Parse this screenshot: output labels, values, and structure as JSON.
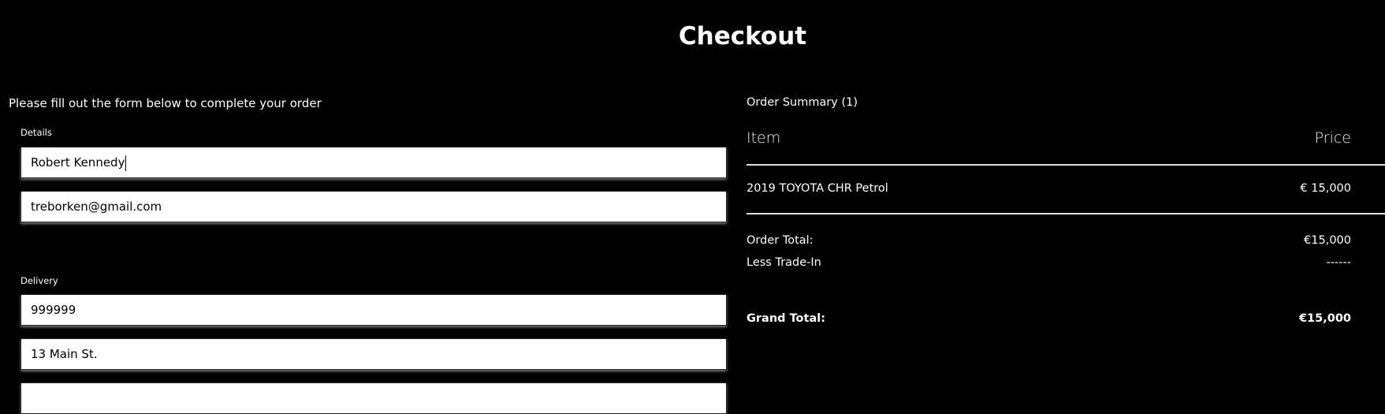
{
  "page": {
    "title": "Checkout",
    "intro": "Please fill out the form below to complete your order"
  },
  "form": {
    "details_label": "Details",
    "name_value": "Robert Kennedy",
    "email_value": "treborken@gmail.com",
    "delivery_label": "Delivery",
    "delivery_field1_value": "999999",
    "address_value": "13 Main St."
  },
  "summary": {
    "heading": "Order Summary (1)",
    "col_item": "Item",
    "col_price": "Price",
    "items": [
      {
        "name": "2019 TOYOTA CHR Petrol",
        "price": "€ 15,000"
      }
    ],
    "order_total_label": "Order Total:",
    "order_total_value": "€15,000",
    "trade_in_label": "Less Trade-In",
    "trade_in_value": "------",
    "grand_total_label": "Grand Total:",
    "grand_total_value": "€15,000"
  }
}
